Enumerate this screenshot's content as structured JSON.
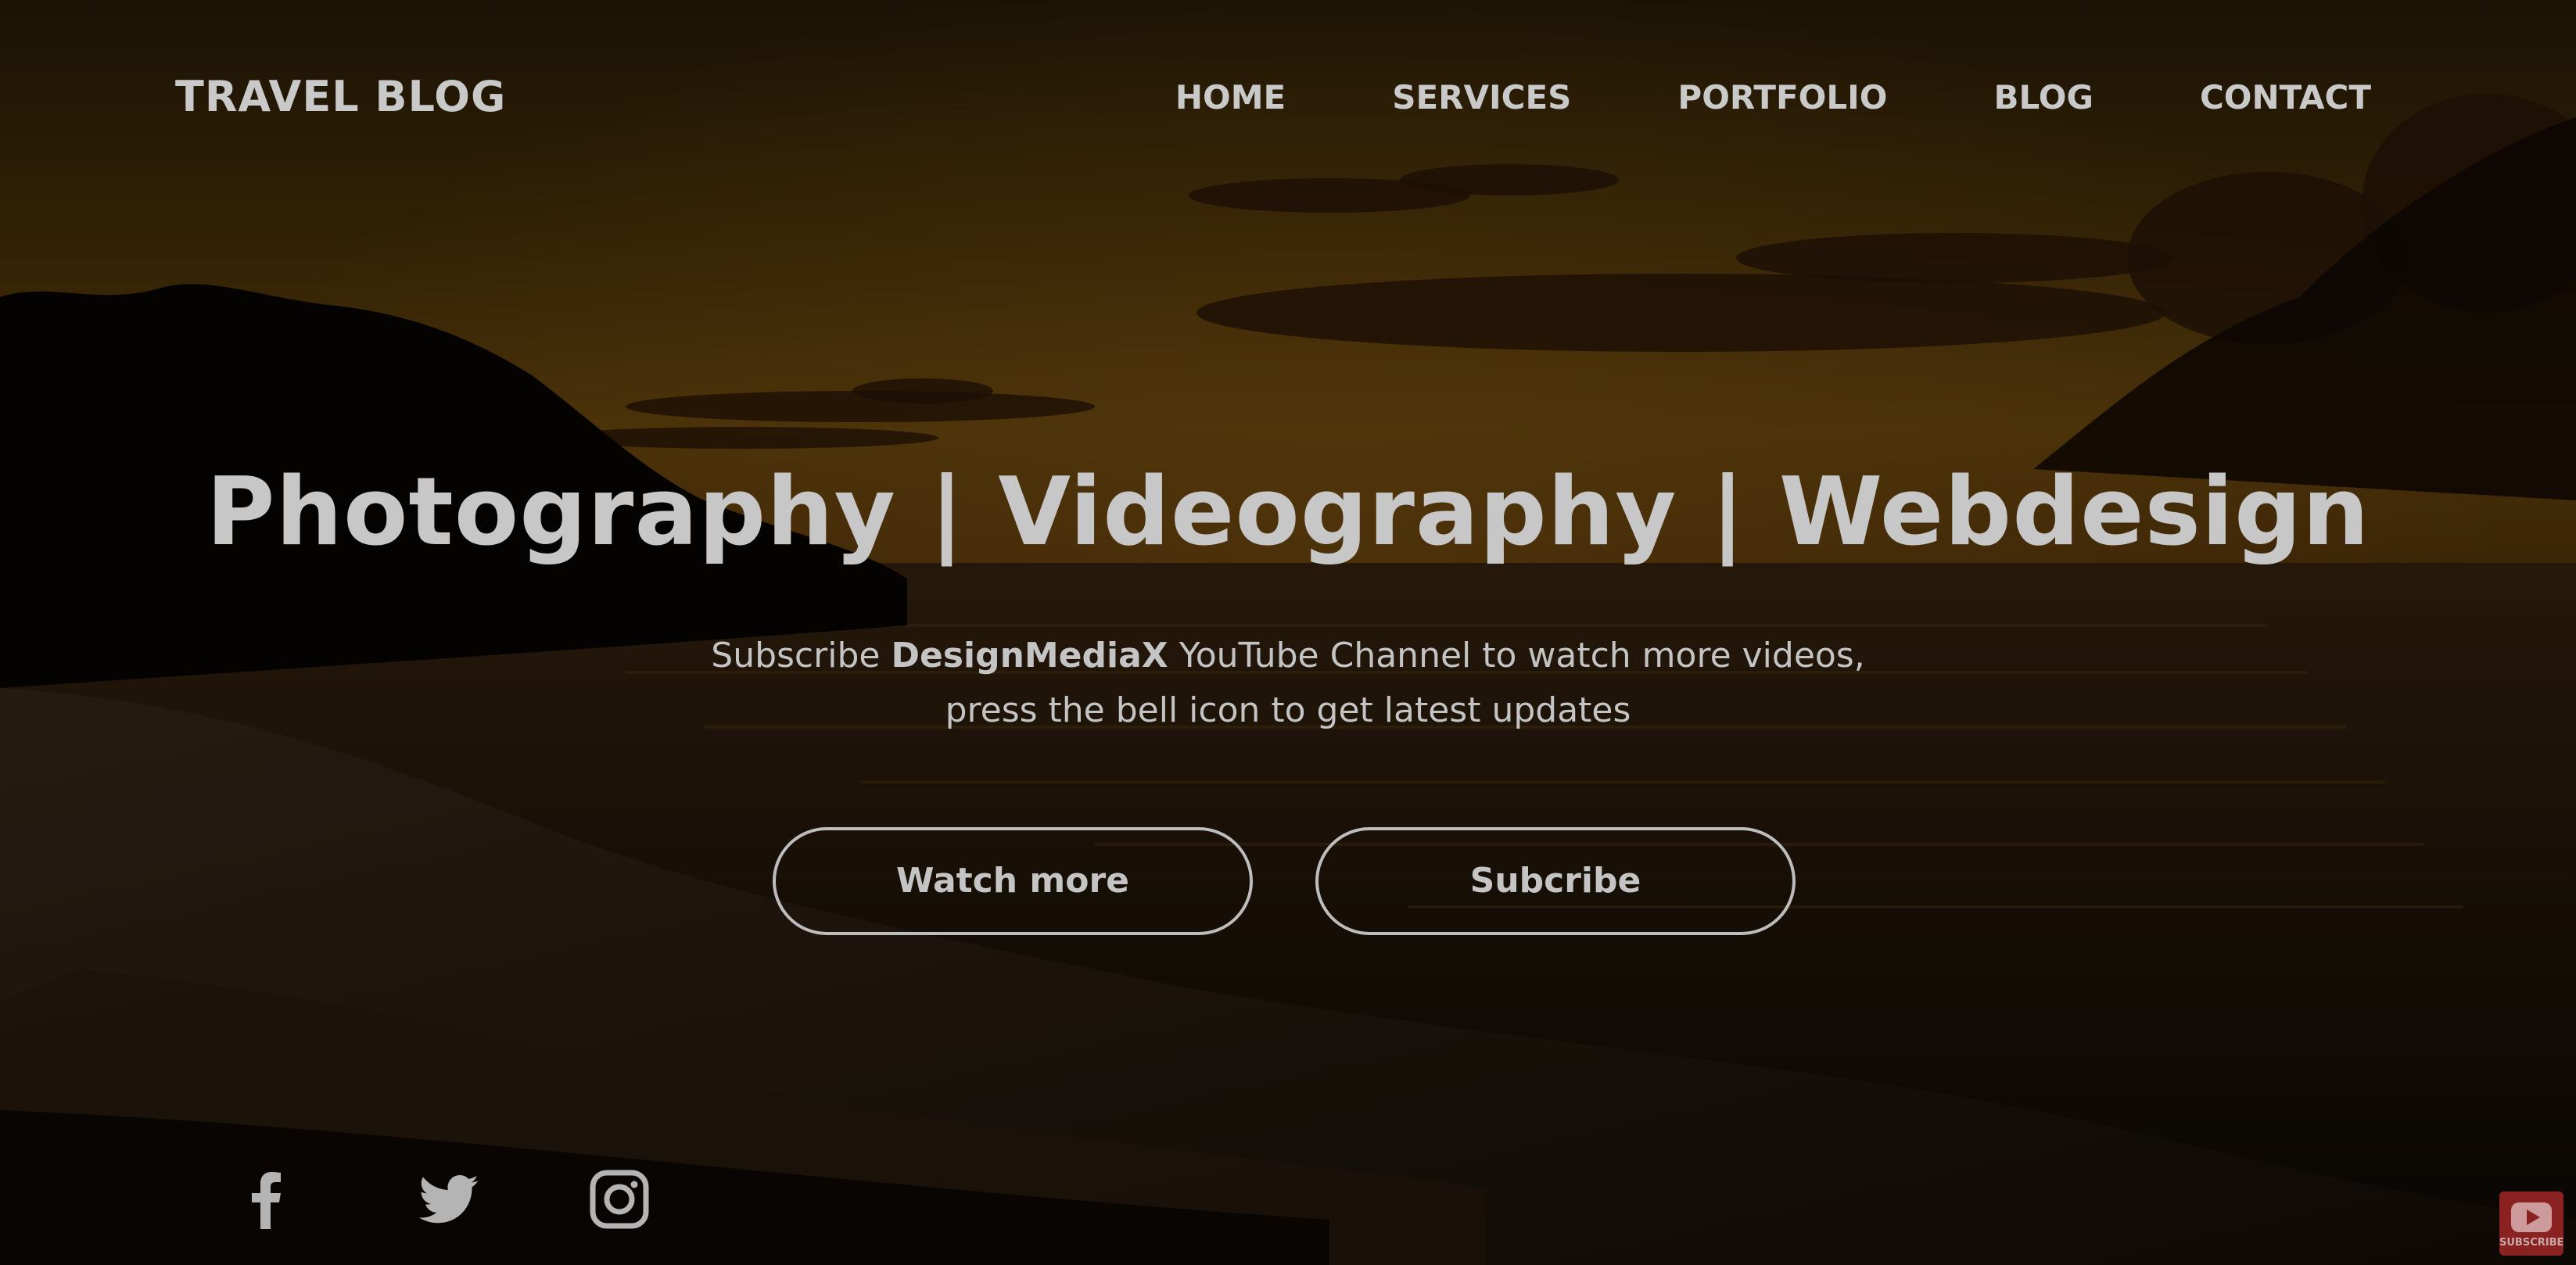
{
  "header": {
    "logo": "TRAVEL BLOG",
    "nav": [
      "HOME",
      "SERVICES",
      "PORTFOLIO",
      "BLOG",
      "CONTACT"
    ]
  },
  "hero": {
    "headline": "Photography | Videography | Webdesign",
    "subtext_line1_prefix": "Subscribe ",
    "subtext_line1_brand": "DesignMediaX",
    "subtext_line1_suffix": " YouTube Channel to watch more videos,",
    "subtext_line2": "press the bell icon to get latest updates",
    "buttons": {
      "watch_more": "Watch more",
      "subscribe": "Subcribe"
    }
  },
  "social": {
    "icons": [
      "facebook-icon",
      "twitter-icon",
      "instagram-icon"
    ]
  },
  "badge": {
    "label": "SUBSCRIBE",
    "icon": "youtube-play-icon"
  },
  "colors": {
    "text": "#c9c9c9",
    "sky_glow": "#8a5a10",
    "overlay": "#000000",
    "badge": "#8a2222"
  }
}
